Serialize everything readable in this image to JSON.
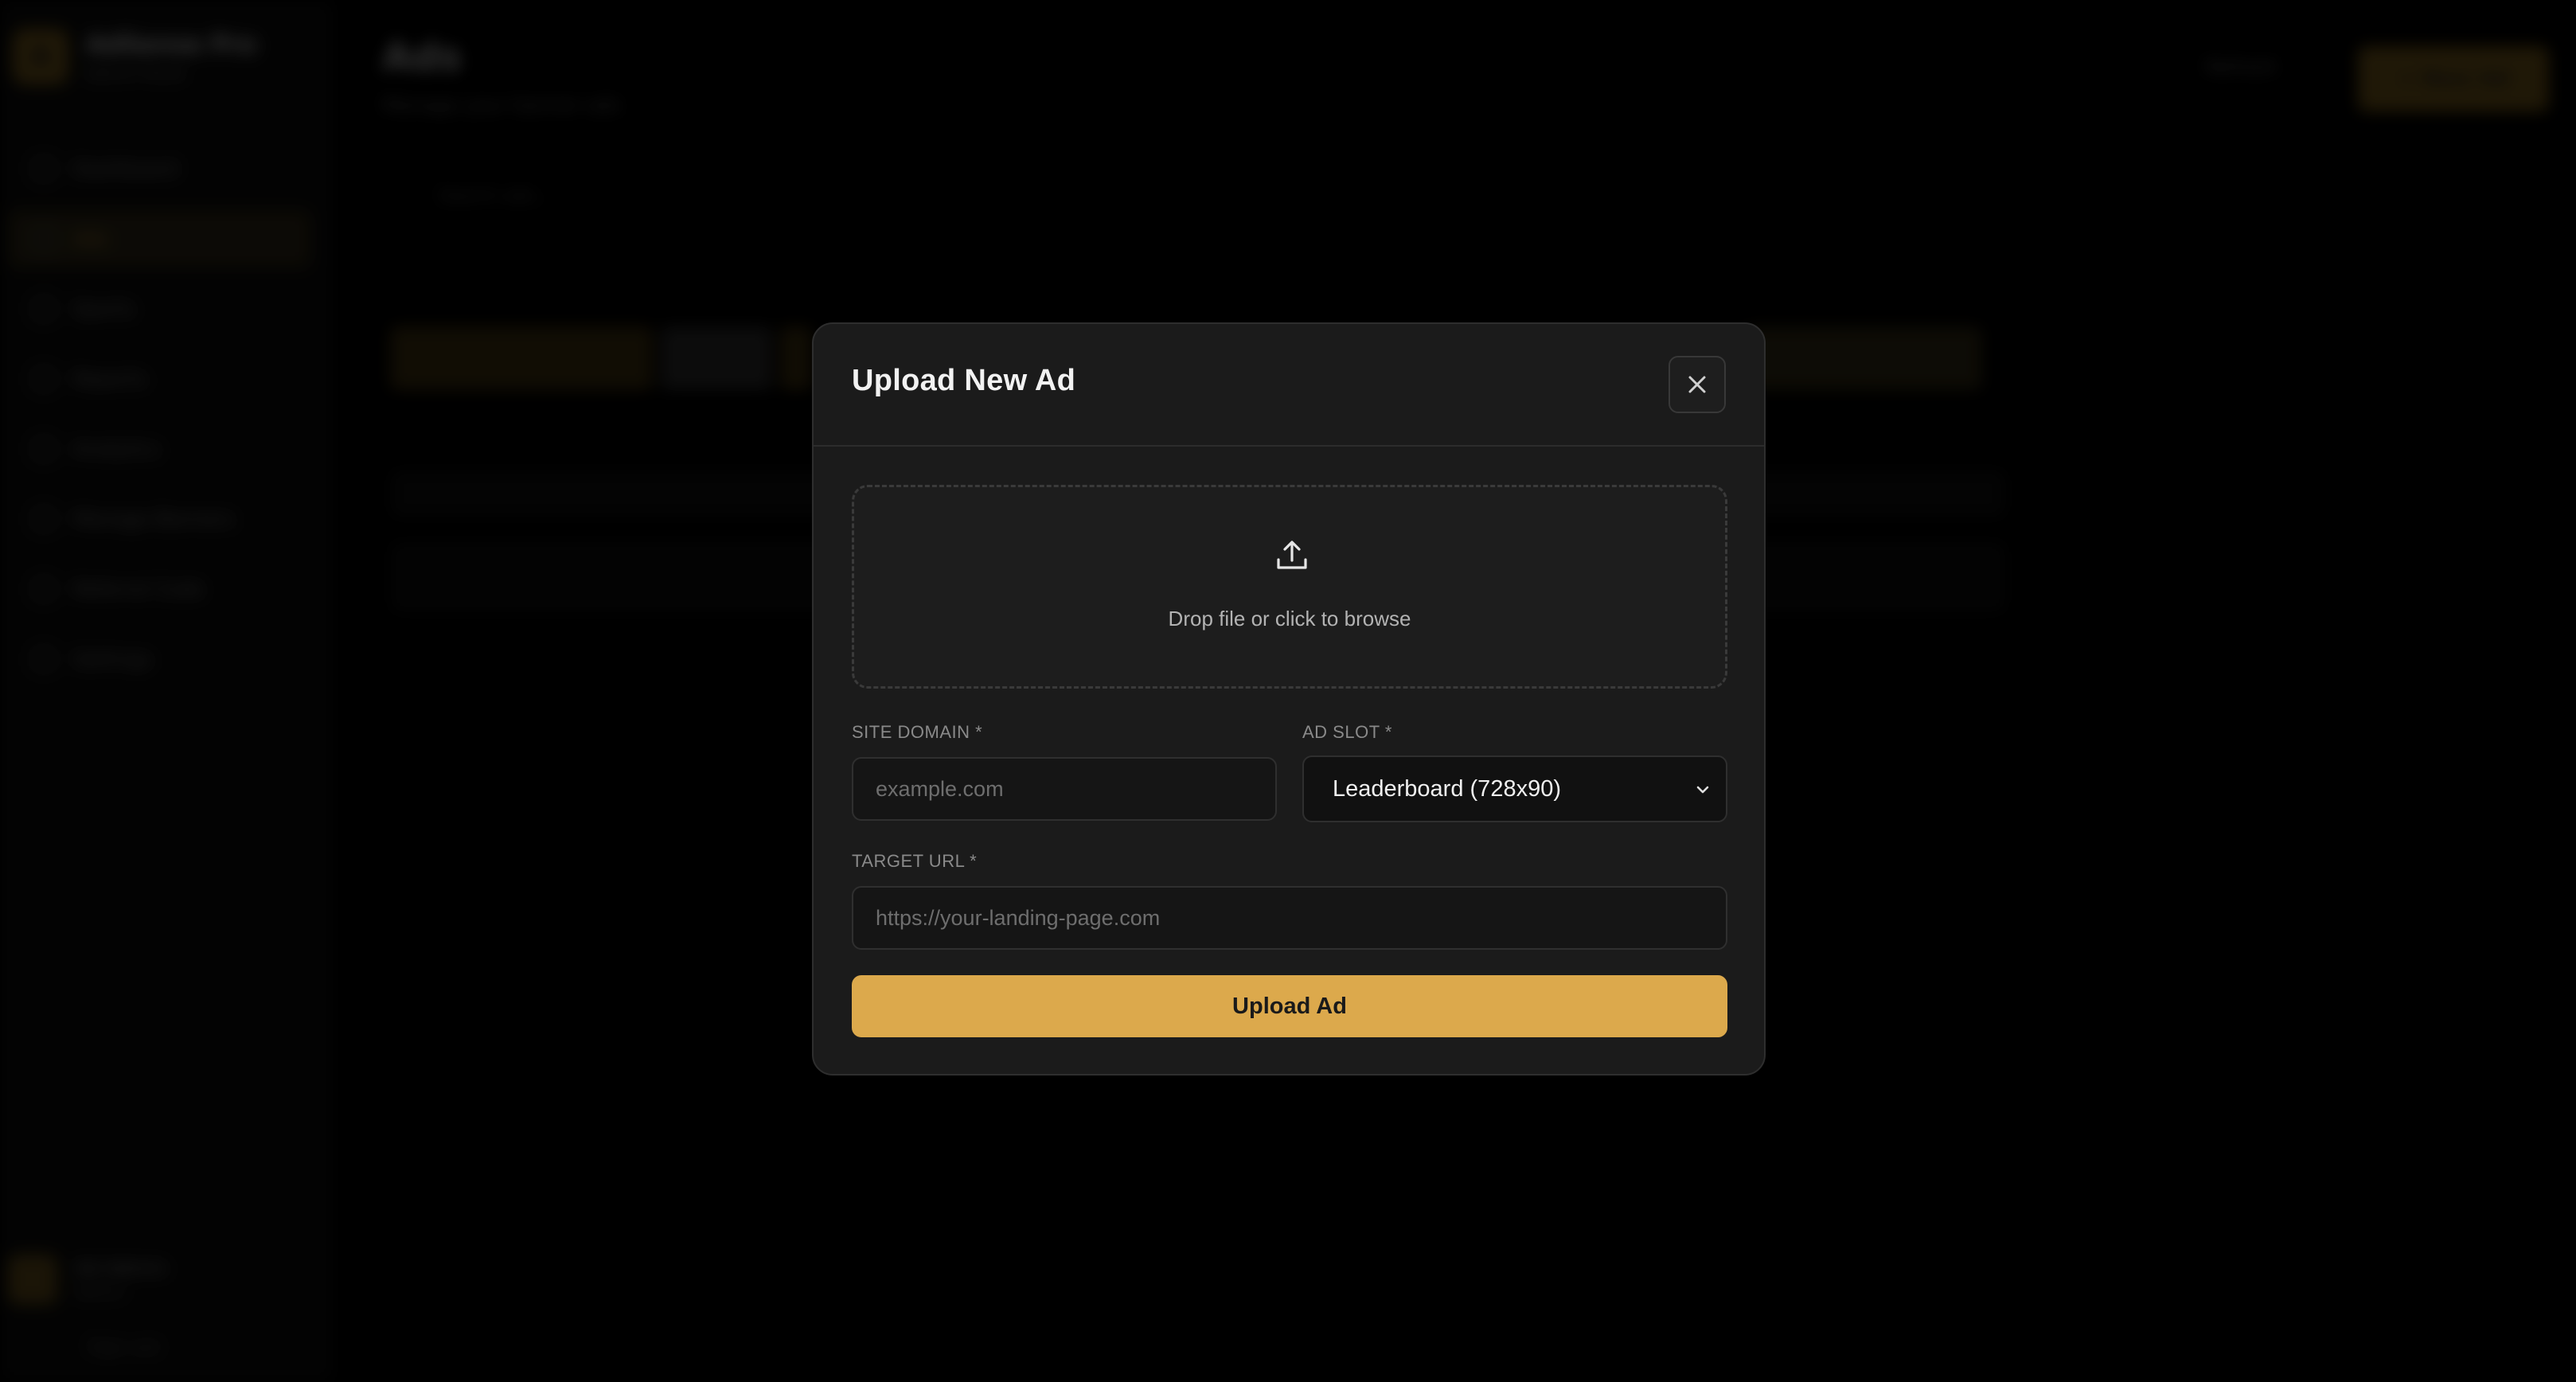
{
  "background": {
    "brand": {
      "name": "AdSense Pro",
      "subtitle": "Admin Panel",
      "logo_letter": "A"
    },
    "nav": [
      {
        "label": "Dashboard",
        "icon": "dashboard-icon"
      },
      {
        "label": "Ads",
        "icon": "image-icon",
        "active": true
      },
      {
        "label": "Sports",
        "icon": "trophy-icon"
      },
      {
        "label": "Reports",
        "icon": "chart-icon"
      },
      {
        "label": "Analytics",
        "icon": "analytics-icon"
      },
      {
        "label": "Manage Banners",
        "icon": "banner-icon"
      },
      {
        "label": "Referral Code",
        "icon": "ticket-icon"
      },
      {
        "label": "Settings",
        "icon": "gear-icon"
      }
    ],
    "user": {
      "name": "Ad Admin",
      "role": "Admin"
    },
    "signout_label": "Sign out",
    "page": {
      "title": "Ads",
      "subtitle": "Manage your banner ads"
    },
    "refresh_label": "Refresh",
    "new_ad_label": "+ New Ad",
    "search_placeholder": "Search ads..."
  },
  "modal": {
    "title": "Upload New Ad",
    "dropzone_text": "Drop file or click to browse",
    "site_domain": {
      "label": "SITE DOMAIN *",
      "placeholder": "example.com",
      "value": ""
    },
    "ad_slot": {
      "label": "AD SLOT *",
      "value": "Leaderboard (728x90)"
    },
    "target_url": {
      "label": "TARGET URL *",
      "placeholder": "https://your-landing-page.com",
      "value": ""
    },
    "submit_label": "Upload Ad"
  },
  "colors": {
    "accent": "#dca94c",
    "modal_bg": "#1b1b1b",
    "input_bg": "#151515"
  }
}
